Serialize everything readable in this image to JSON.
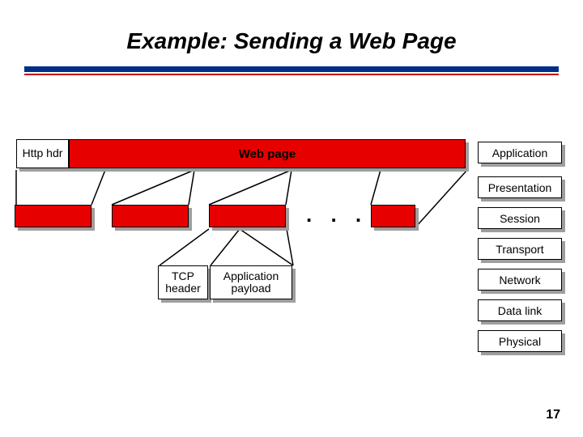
{
  "title": "Example: Sending a Web Page",
  "top_bar": {
    "http_hdr": "Http hdr",
    "web_page": "Web page"
  },
  "ellipsis": ". . .",
  "segment_labels": {
    "tcp_header": "TCP header",
    "app_payload": "Application payload"
  },
  "layers": {
    "application": "Application",
    "presentation": "Presentation",
    "session": "Session",
    "transport": "Transport",
    "network": "Network",
    "datalink": "Data link",
    "physical": "Physical"
  },
  "page_number": "17"
}
